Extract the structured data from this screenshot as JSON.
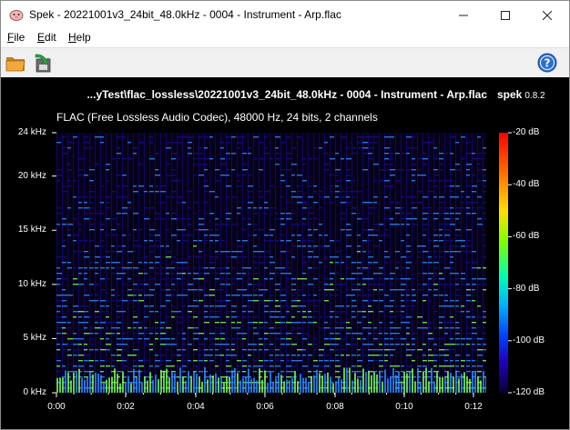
{
  "window": {
    "title": "Spek - 20221001v3_24bit_48.0kHz - 0004 - Instrument - Arp.flac"
  },
  "menu": {
    "file": {
      "accel": "F",
      "rest": "ile"
    },
    "edit": {
      "accel": "E",
      "rest": "dit"
    },
    "help": {
      "accel": "H",
      "rest": "elp"
    }
  },
  "toolbar": {
    "open_icon": "folder-open-icon",
    "save_icon": "save-icon",
    "about_icon": "help-icon"
  },
  "spectrogram": {
    "file_title": "...yTest\\flac_lossless\\20221001v3_24bit_48.0kHz - 0004 - Instrument - Arp.flac",
    "logo": "spek",
    "version": "0.8.2",
    "file_info": "FLAC (Free Lossless Audio Codec), 48000 Hz, 24 bits, 2 channels",
    "y_ticks": [
      "24 kHz",
      "20 kHz",
      "15 kHz",
      "10 kHz",
      "5 kHz",
      "0 kHz"
    ],
    "x_ticks": [
      "0:00",
      "0:02",
      "0:04",
      "0:06",
      "0:08",
      "0:10",
      "0:12"
    ],
    "db_ticks": [
      "-20 dB",
      "-40 dB",
      "-60 dB",
      "-80 dB",
      "-100 dB",
      "-120 dB"
    ]
  },
  "colors": {
    "background": "#000000",
    "text": "#ffffff",
    "spectrum_low": "#1a0a8a",
    "spectrum_mid": "#2a8cff",
    "spectrum_high": "#7dff4a"
  }
}
